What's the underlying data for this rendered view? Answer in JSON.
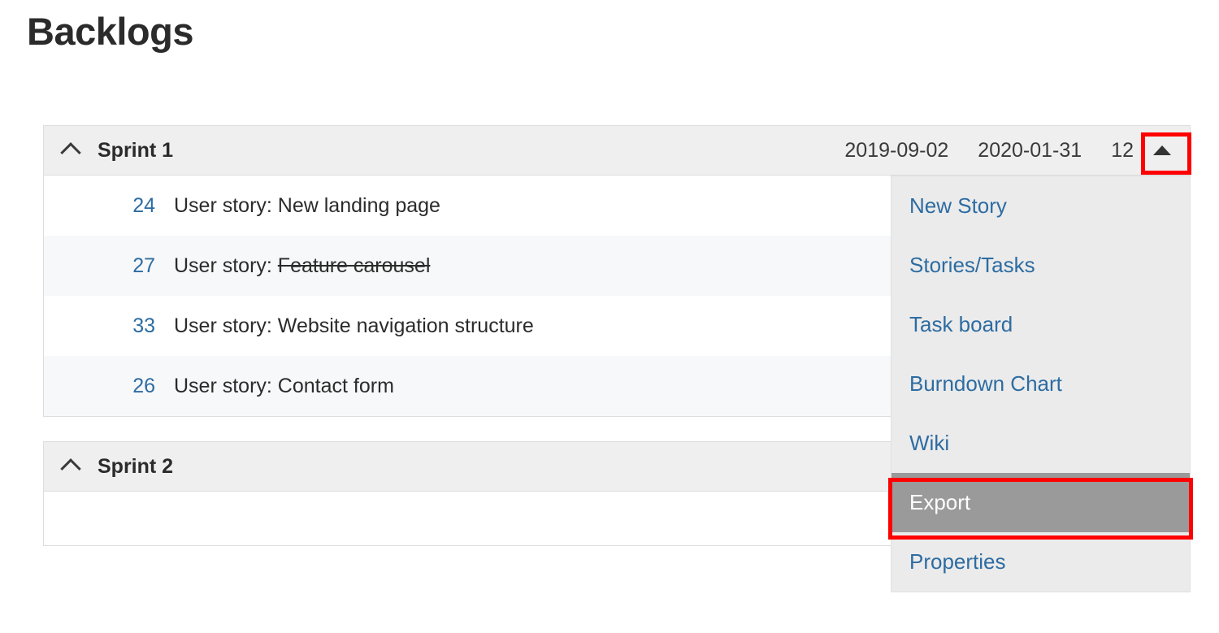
{
  "page": {
    "title": "Backlogs"
  },
  "sprints": [
    {
      "name": "Sprint 1",
      "collapse_icon": "chevron-up-icon",
      "start_date": "2019-09-02",
      "end_date": "2020-01-31",
      "count": "12",
      "menu_toggle_icon": "caret-up-icon",
      "stories": [
        {
          "id": "24",
          "prefix": "User story: ",
          "name": "New landing page",
          "struck": false
        },
        {
          "id": "27",
          "prefix": "User story: ",
          "name": "Feature carousel",
          "struck": true
        },
        {
          "id": "33",
          "prefix": "User story: ",
          "name": "Website navigation structure",
          "struck": false
        },
        {
          "id": "26",
          "prefix": "User story: ",
          "name": "Contact form",
          "struck": false
        }
      ]
    },
    {
      "name": "Sprint 2",
      "collapse_icon": "chevron-up-icon",
      "start_date": "",
      "end_date": "",
      "count": "",
      "stories": []
    }
  ],
  "dropdown_menu": {
    "items": [
      {
        "label": "New Story",
        "selected": false
      },
      {
        "label": "Stories/Tasks",
        "selected": false
      },
      {
        "label": "Task board",
        "selected": false
      },
      {
        "label": "Burndown Chart",
        "selected": false
      },
      {
        "label": "Wiki",
        "selected": false
      },
      {
        "label": "Export",
        "selected": true
      },
      {
        "label": "Properties",
        "selected": false
      }
    ]
  },
  "colors": {
    "link": "#2d6ca2",
    "header_bg": "#efefef",
    "menu_bg": "#ebebeb",
    "menu_selected_bg": "#9a9a9a",
    "highlight_border": "#ff0000",
    "row_alt_bg": "#f7f8f9",
    "text": "#2b2b2b"
  }
}
